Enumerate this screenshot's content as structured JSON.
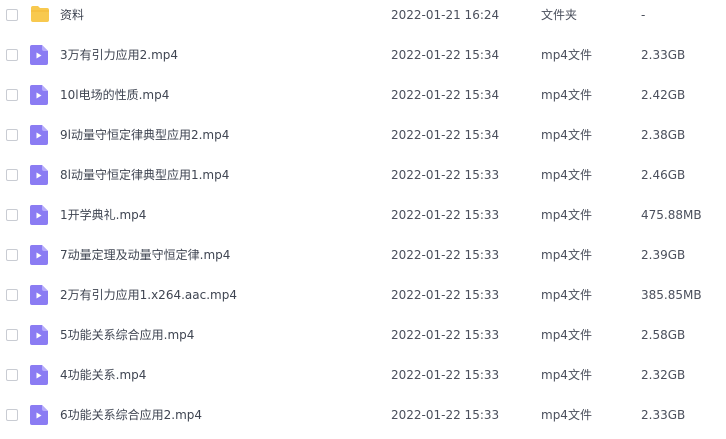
{
  "files": [
    {
      "name": "资料",
      "date": "2022-01-21 16:24",
      "type": "文件夹",
      "size": "-",
      "icon": "folder-icon"
    },
    {
      "name": "3万有引力应用2.mp4",
      "date": "2022-01-22 15:34",
      "type": "mp4文件",
      "size": "2.33GB",
      "icon": "video-file-icon"
    },
    {
      "name": "10l电场的性质.mp4",
      "date": "2022-01-22 15:34",
      "type": "mp4文件",
      "size": "2.42GB",
      "icon": "video-file-icon"
    },
    {
      "name": "9l动量守恒定律典型应用2.mp4",
      "date": "2022-01-22 15:34",
      "type": "mp4文件",
      "size": "2.38GB",
      "icon": "video-file-icon"
    },
    {
      "name": "8l动量守恒定律典型应用1.mp4",
      "date": "2022-01-22 15:33",
      "type": "mp4文件",
      "size": "2.46GB",
      "icon": "video-file-icon"
    },
    {
      "name": "1开学典礼.mp4",
      "date": "2022-01-22 15:33",
      "type": "mp4文件",
      "size": "475.88MB",
      "icon": "video-file-icon"
    },
    {
      "name": "7动量定理及动量守恒定律.mp4",
      "date": "2022-01-22 15:33",
      "type": "mp4文件",
      "size": "2.39GB",
      "icon": "video-file-icon"
    },
    {
      "name": "2万有引力应用1.x264.aac.mp4",
      "date": "2022-01-22 15:33",
      "type": "mp4文件",
      "size": "385.85MB",
      "icon": "video-file-icon"
    },
    {
      "name": "5功能关系综合应用.mp4",
      "date": "2022-01-22 15:33",
      "type": "mp4文件",
      "size": "2.58GB",
      "icon": "video-file-icon"
    },
    {
      "name": "4功能关系.mp4",
      "date": "2022-01-22 15:33",
      "type": "mp4文件",
      "size": "2.32GB",
      "icon": "video-file-icon"
    },
    {
      "name": "6功能关系综合应用2.mp4",
      "date": "2022-01-22 15:33",
      "type": "mp4文件",
      "size": "2.33GB",
      "icon": "video-file-icon"
    }
  ],
  "colors": {
    "folder": "#f8c94f",
    "video": "#8b7cf3",
    "text": "#4a4f5c"
  }
}
